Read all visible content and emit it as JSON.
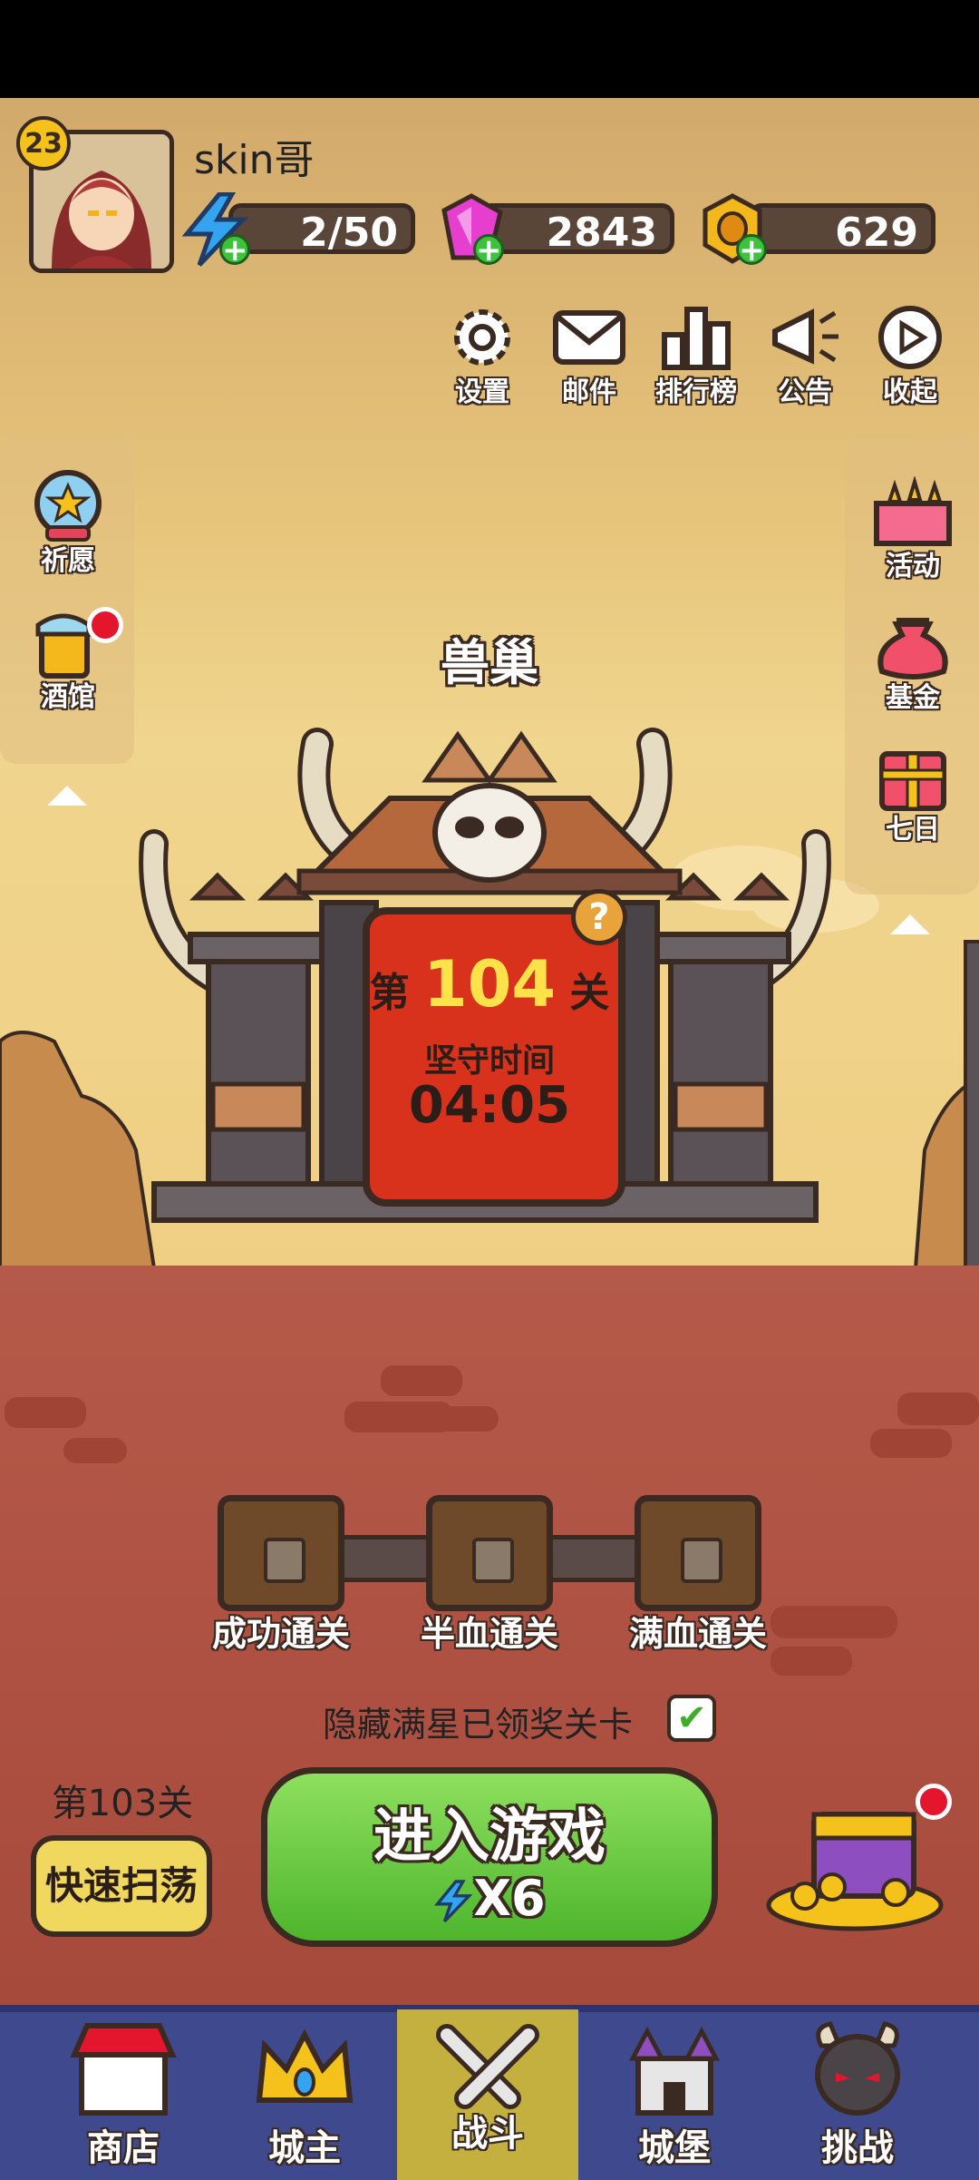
{
  "player": {
    "level": "23",
    "name": "skin哥"
  },
  "resources": {
    "energy": "2/50",
    "gems": "2843",
    "coins": "629"
  },
  "top_menu": [
    {
      "label": "设置",
      "icon": "gear-icon"
    },
    {
      "label": "邮件",
      "icon": "mail-icon"
    },
    {
      "label": "排行榜",
      "icon": "leaderboard-icon"
    },
    {
      "label": "公告",
      "icon": "megaphone-icon"
    },
    {
      "label": "收起",
      "icon": "play-icon"
    }
  ],
  "left_menu": [
    {
      "label": "祈愿",
      "icon": "wish-orb-icon"
    },
    {
      "label": "酒馆",
      "icon": "tavern-mug-icon"
    }
  ],
  "right_menu": [
    {
      "label": "活动",
      "icon": "event-gift-icon"
    },
    {
      "label": "基金",
      "icon": "fund-bag-icon"
    },
    {
      "label": "七日",
      "icon": "seven-day-gift-icon"
    }
  ],
  "stage": {
    "area_name": "兽巢",
    "prefix": "第",
    "number": "104",
    "suffix": "关",
    "defend_label": "坚守时间",
    "defend_time": "04:05"
  },
  "chests": [
    {
      "label": "成功通关"
    },
    {
      "label": "半血通关"
    },
    {
      "label": "满血通关"
    }
  ],
  "hide_cleared_label": "隐藏满星已领奖关卡",
  "hide_cleared_checked": true,
  "sweep": {
    "stage_label": "第103关",
    "button_label": "快速扫荡"
  },
  "enter": {
    "label": "进入游戏",
    "cost": "X6"
  },
  "nav": [
    {
      "label": "商店",
      "icon": "shop-icon"
    },
    {
      "label": "城主",
      "icon": "crown-icon"
    },
    {
      "label": "战斗",
      "icon": "crossed-swords-icon",
      "active": true
    },
    {
      "label": "城堡",
      "icon": "castle-icon"
    },
    {
      "label": "挑战",
      "icon": "demon-helmet-icon"
    }
  ],
  "colors": {
    "outline": "#3a2a22",
    "sky": "#e6c47a",
    "ground": "#ad5042",
    "nav_bg": "#3f4a8e",
    "nav_active": "#c4b03f",
    "enter_green": "#6acb46",
    "banner_red": "#d8311c",
    "stage_number": "#ffe14a"
  }
}
